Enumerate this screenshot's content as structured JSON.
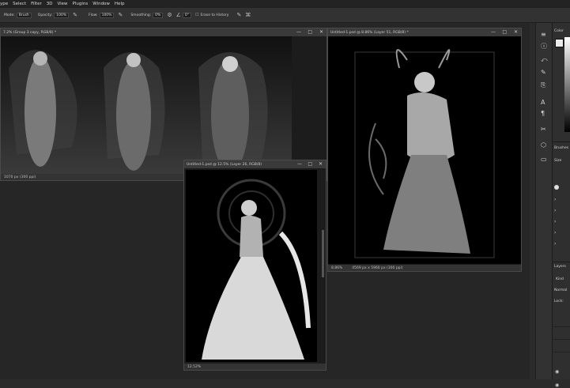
{
  "menu": [
    "ype",
    "Select",
    "Filter",
    "3D",
    "View",
    "Plugins",
    "Window",
    "Help"
  ],
  "options": {
    "mode_label": "Mode:",
    "mode_value": "Brush",
    "opacity_label": "Opacity:",
    "opacity_value": "100%",
    "flow_label": "Flow:",
    "flow_value": "100%",
    "smoothing_label": "Smoothing:",
    "smoothing_value": "0%",
    "angle_value": "0°",
    "erase_history": "Erase to History"
  },
  "doc1": {
    "title": "7.2% (Group 3 copy, RGB/8) *",
    "status": "1070 px (300 ppi)"
  },
  "doc2": {
    "title": "Untitled-1.psd @ 12.5% (Layer 26, RGB/8)",
    "zoom": "12.52%"
  },
  "doc3": {
    "title": "Untitled-1.psd @ 8.86% (Layer 51, RGB/8) *",
    "zoom": "8.86%",
    "status": "4569 px x 5960 px (300 ppi)"
  },
  "panels": {
    "color": "Color",
    "brushes": "Brushes",
    "size": "Size",
    "layers": "Layers",
    "kind": "Kind",
    "normal": "Normal",
    "lock": "Lock:"
  },
  "colors": {
    "menubar": "#232323",
    "optbar": "#323232",
    "workspace": "#262626",
    "canvas": "#000000"
  }
}
